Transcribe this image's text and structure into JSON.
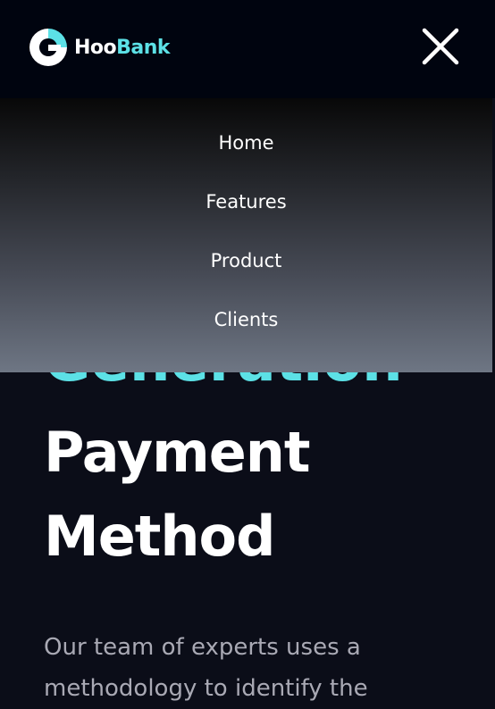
{
  "header": {
    "brand_prefix": "Hoo",
    "brand_suffix": "Bank",
    "logo_icon": "hoobank-logo-icon",
    "close_icon": "close-icon"
  },
  "menu": {
    "items": [
      {
        "label": "Home"
      },
      {
        "label": "Features"
      },
      {
        "label": "Product"
      },
      {
        "label": "Clients"
      }
    ]
  },
  "hero": {
    "heading_line_gradient": "Generation",
    "heading_line_2": "Payment",
    "heading_line_3": "Method",
    "description": "Our team of experts uses a methodology to identify the"
  },
  "colors": {
    "accent": "#5ce1e6",
    "background": "#00040f",
    "text_dim": "#a9a9b4"
  }
}
